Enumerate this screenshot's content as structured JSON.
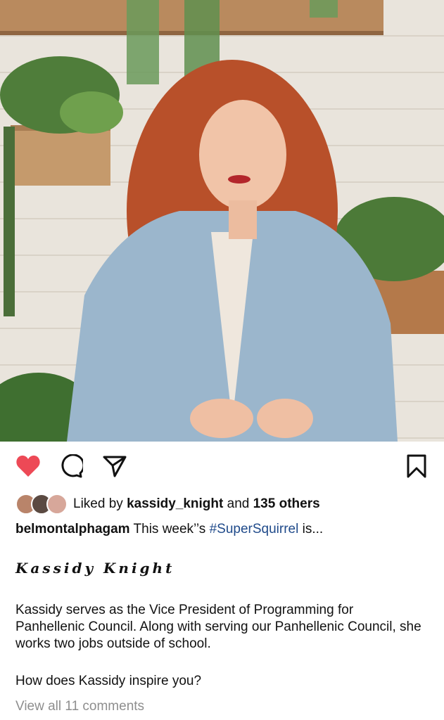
{
  "post": {
    "image_alt": "Woman with long red wavy hair in denim jacket in front of wooden wall with plants",
    "likes": {
      "prefix": "Liked by",
      "user": "kassidy_knight",
      "joiner": "and",
      "others": "135 others"
    },
    "caption": {
      "username": "belmontalphagam",
      "text_before": "This week’’s",
      "hashtag": "#SuperSquirrel",
      "text_after": "is..."
    },
    "fancy_name": "Kassidy Knight",
    "paragraph": "Kassidy serves as the Vice President of Programming for Panhellenic Council. Along with serving our Panhellenic Council, she works two jobs outside of school.",
    "question": "How does Kassidy inspire you?",
    "view_all_comments": "View all 11 comments"
  },
  "colors": {
    "like": "#ed4956",
    "hashtag": "#1f4a8a",
    "muted": "#8e8e8e"
  },
  "icons": [
    "heart-icon",
    "comment-icon",
    "share-icon",
    "bookmark-icon"
  ]
}
